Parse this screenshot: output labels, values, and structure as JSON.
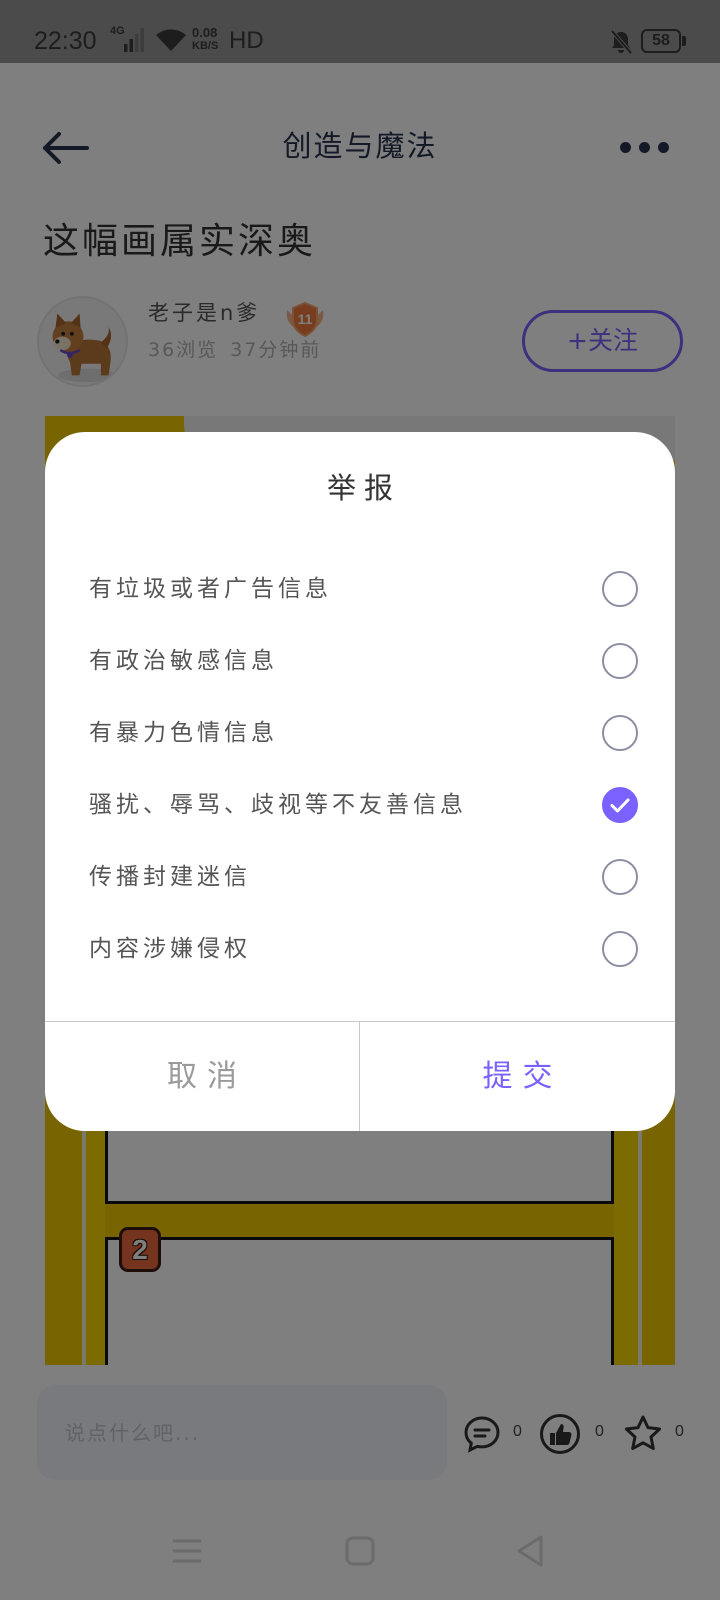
{
  "status_bar": {
    "time": "22:30",
    "network": "4G",
    "speed_value": "0.08",
    "speed_unit": "KB/S",
    "quality": "HD",
    "battery_level": "58",
    "icons": {
      "signal": "signal-icon",
      "wifi": "wifi-icon",
      "mute": "bell-off-icon",
      "battery": "battery-icon"
    }
  },
  "header": {
    "title": "创造与魔法",
    "back_icon": "arrow-left-icon",
    "more_icon": "more-dots-icon"
  },
  "post": {
    "title": "这幅画属实深奥",
    "author": {
      "name": "老子是n爹",
      "level": "11",
      "views": "36浏览",
      "posted": "37分钟前"
    },
    "follow_label": "+关注",
    "image": {
      "panel_number": "2"
    }
  },
  "comment_bar": {
    "placeholder": "说点什么吧...",
    "comment_count": "0",
    "like_count": "0",
    "favorite_count": "0",
    "icons": {
      "comment": "comment-icon",
      "like": "thumbs-up-icon",
      "favorite": "star-icon"
    }
  },
  "nav_bar": {
    "icons": {
      "menu": "menu-icon",
      "home": "square-icon",
      "back": "back-triangle-icon"
    }
  },
  "report_dialog": {
    "title": "举报",
    "options": [
      {
        "label": "有垃圾或者广告信息",
        "checked": false
      },
      {
        "label": "有政治敏感信息",
        "checked": false
      },
      {
        "label": "有暴力色情信息",
        "checked": false
      },
      {
        "label": "骚扰、辱骂、歧视等不友善信息",
        "checked": true
      },
      {
        "label": "传播封建迷信",
        "checked": false
      },
      {
        "label": "内容涉嫌侵权",
        "checked": false
      }
    ],
    "cancel_label": "取消",
    "submit_label": "提交"
  },
  "colors": {
    "accent": "#7B61FF",
    "overlay": "rgba(0,0,0,0.5)",
    "cancel_text": "#9A9A9A",
    "artwork_yellow": "#F0C800",
    "artwork_badge": "#E8693A"
  }
}
